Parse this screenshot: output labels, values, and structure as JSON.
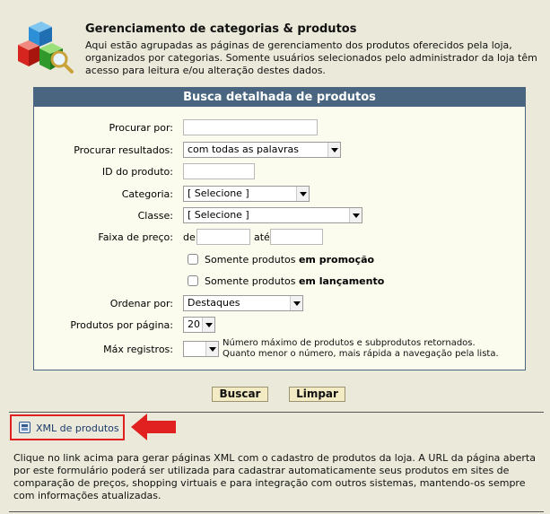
{
  "header": {
    "title": "Gerenciamento de categorias & produtos",
    "description": "Aqui estão agrupadas as páginas de gerenciamento dos produtos oferecidos pela loja, organizados por categorias. Somente usuários selecionados pelo administrador da loja têm acesso para leitura e/ou alteração destes dados.",
    "logo_icon": "categories-search-icon"
  },
  "search_panel": {
    "title": "Busca detalhada de produtos",
    "procurar_por": {
      "label": "Procurar por:",
      "value": ""
    },
    "procurar_resultados": {
      "label": "Procurar resultados:",
      "selected": "com todas as palavras"
    },
    "id_produto": {
      "label": "ID do produto:",
      "value": ""
    },
    "categoria": {
      "label": "Categoria:",
      "selected": "[ Selecione ]"
    },
    "classe": {
      "label": "Classe:",
      "selected": "[ Selecione ]"
    },
    "faixa_preco": {
      "label": "Faixa de preço:",
      "de": "de",
      "ate": "até",
      "min": "",
      "max": ""
    },
    "promocao": {
      "prefix": "Somente produtos ",
      "bold": "em promoção",
      "checked": false
    },
    "lancamento": {
      "prefix": "Somente produtos ",
      "bold": "em lançamento",
      "checked": false
    },
    "ordenar_por": {
      "label": "Ordenar por:",
      "selected": "Destaques"
    },
    "produtos_por_pagina": {
      "label": "Produtos por página:",
      "selected": "20"
    },
    "max_registros": {
      "label": "Máx registros:",
      "selected": "",
      "hint_line1": "Número máximo de produtos e subprodutos retornados.",
      "hint_line2": "Quanto menor o número, mais rápida a navegação pela lista."
    }
  },
  "buttons": {
    "buscar": "Buscar",
    "limpar": "Limpar"
  },
  "xml": {
    "link_label": "XML de produtos",
    "icon": "xml-document-icon",
    "highlight_color": "#e0211f"
  },
  "footer": {
    "text": "Clique no link acima para gerar páginas XML com o cadastro de produtos da loja. A URL da página aberta por este formulário poderá ser utilizada para cadastrar automaticamente seus produtos em sites de comparação de preços, shopping virtuais e para integração com outros sistemas, mantendo-os sempre com informações atualizadas."
  },
  "colors": {
    "panel_header": "#4a6580",
    "background": "#ebe9da",
    "panel_bg": "#fbfbee",
    "button_bg": "#f3ebc4",
    "link": "#1a3a6b"
  }
}
